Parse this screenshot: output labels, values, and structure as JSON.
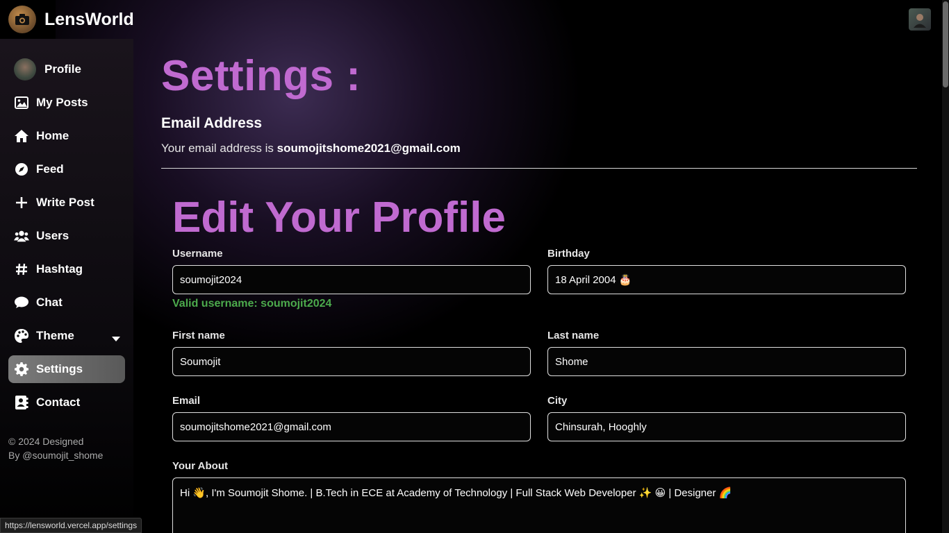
{
  "app": {
    "title": "LensWorld"
  },
  "sidebar": {
    "items": [
      {
        "label": "Profile",
        "icon": "avatar"
      },
      {
        "label": "My Posts",
        "icon": "image-icon"
      },
      {
        "label": "Home",
        "icon": "home-icon"
      },
      {
        "label": "Feed",
        "icon": "compass-icon"
      },
      {
        "label": "Write Post",
        "icon": "plus-icon"
      },
      {
        "label": "Users",
        "icon": "users-icon"
      },
      {
        "label": "Hashtag",
        "icon": "hashtag-icon"
      },
      {
        "label": "Chat",
        "icon": "chat-icon"
      },
      {
        "label": "Theme",
        "icon": "palette-icon"
      },
      {
        "label": "Settings",
        "icon": "gear-icon"
      },
      {
        "label": "Contact",
        "icon": "contact-icon"
      }
    ],
    "footer_line1": "© 2024 Designed",
    "footer_line2": "By @soumojit_shome"
  },
  "settings": {
    "title": "Settings :",
    "email_heading": "Email Address",
    "email_prefix": "Your email address is ",
    "email_value": "soumojitshome2021@gmail.com"
  },
  "profile_form": {
    "title": "Edit Your Profile",
    "username_label": "Username",
    "username_value": "soumojit2024",
    "username_status": "Valid username: soumojit2024",
    "birthday_label": "Birthday",
    "birthday_value": "18 April 2004 🎂",
    "first_name_label": "First name",
    "first_name_value": "Soumojit",
    "last_name_label": "Last name",
    "last_name_value": "Shome",
    "email_label": "Email",
    "email_value": "soumojitshome2021@gmail.com",
    "city_label": "City",
    "city_value": "Chinsurah, Hooghly",
    "about_label": "Your About",
    "about_value": "Hi 👋, I'm Soumojit Shome. | B.Tech in ECE at Academy of Technology | Full Stack Web Developer ✨ 😀 | Designer 🌈"
  },
  "status_bar": {
    "url": "https://lensworld.vercel.app/settings"
  },
  "colors": {
    "accent": "#c06ad0",
    "valid": "#4caa4c",
    "active_nav": "#6b6b6b"
  }
}
